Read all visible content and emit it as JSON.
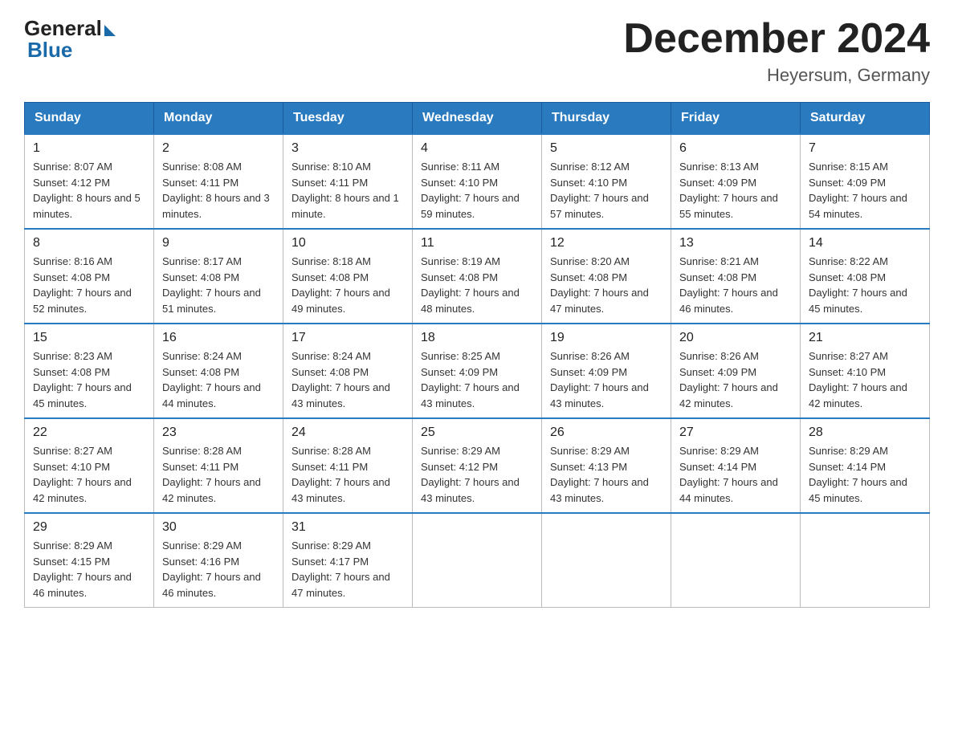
{
  "logo": {
    "general": "General",
    "blue": "Blue"
  },
  "title": "December 2024",
  "location": "Heyersum, Germany",
  "weekdays": [
    "Sunday",
    "Monday",
    "Tuesday",
    "Wednesday",
    "Thursday",
    "Friday",
    "Saturday"
  ],
  "rows": [
    [
      {
        "day": "1",
        "sunrise": "8:07 AM",
        "sunset": "4:12 PM",
        "daylight": "8 hours and 5 minutes."
      },
      {
        "day": "2",
        "sunrise": "8:08 AM",
        "sunset": "4:11 PM",
        "daylight": "8 hours and 3 minutes."
      },
      {
        "day": "3",
        "sunrise": "8:10 AM",
        "sunset": "4:11 PM",
        "daylight": "8 hours and 1 minute."
      },
      {
        "day": "4",
        "sunrise": "8:11 AM",
        "sunset": "4:10 PM",
        "daylight": "7 hours and 59 minutes."
      },
      {
        "day": "5",
        "sunrise": "8:12 AM",
        "sunset": "4:10 PM",
        "daylight": "7 hours and 57 minutes."
      },
      {
        "day": "6",
        "sunrise": "8:13 AM",
        "sunset": "4:09 PM",
        "daylight": "7 hours and 55 minutes."
      },
      {
        "day": "7",
        "sunrise": "8:15 AM",
        "sunset": "4:09 PM",
        "daylight": "7 hours and 54 minutes."
      }
    ],
    [
      {
        "day": "8",
        "sunrise": "8:16 AM",
        "sunset": "4:08 PM",
        "daylight": "7 hours and 52 minutes."
      },
      {
        "day": "9",
        "sunrise": "8:17 AM",
        "sunset": "4:08 PM",
        "daylight": "7 hours and 51 minutes."
      },
      {
        "day": "10",
        "sunrise": "8:18 AM",
        "sunset": "4:08 PM",
        "daylight": "7 hours and 49 minutes."
      },
      {
        "day": "11",
        "sunrise": "8:19 AM",
        "sunset": "4:08 PM",
        "daylight": "7 hours and 48 minutes."
      },
      {
        "day": "12",
        "sunrise": "8:20 AM",
        "sunset": "4:08 PM",
        "daylight": "7 hours and 47 minutes."
      },
      {
        "day": "13",
        "sunrise": "8:21 AM",
        "sunset": "4:08 PM",
        "daylight": "7 hours and 46 minutes."
      },
      {
        "day": "14",
        "sunrise": "8:22 AM",
        "sunset": "4:08 PM",
        "daylight": "7 hours and 45 minutes."
      }
    ],
    [
      {
        "day": "15",
        "sunrise": "8:23 AM",
        "sunset": "4:08 PM",
        "daylight": "7 hours and 45 minutes."
      },
      {
        "day": "16",
        "sunrise": "8:24 AM",
        "sunset": "4:08 PM",
        "daylight": "7 hours and 44 minutes."
      },
      {
        "day": "17",
        "sunrise": "8:24 AM",
        "sunset": "4:08 PM",
        "daylight": "7 hours and 43 minutes."
      },
      {
        "day": "18",
        "sunrise": "8:25 AM",
        "sunset": "4:09 PM",
        "daylight": "7 hours and 43 minutes."
      },
      {
        "day": "19",
        "sunrise": "8:26 AM",
        "sunset": "4:09 PM",
        "daylight": "7 hours and 43 minutes."
      },
      {
        "day": "20",
        "sunrise": "8:26 AM",
        "sunset": "4:09 PM",
        "daylight": "7 hours and 42 minutes."
      },
      {
        "day": "21",
        "sunrise": "8:27 AM",
        "sunset": "4:10 PM",
        "daylight": "7 hours and 42 minutes."
      }
    ],
    [
      {
        "day": "22",
        "sunrise": "8:27 AM",
        "sunset": "4:10 PM",
        "daylight": "7 hours and 42 minutes."
      },
      {
        "day": "23",
        "sunrise": "8:28 AM",
        "sunset": "4:11 PM",
        "daylight": "7 hours and 42 minutes."
      },
      {
        "day": "24",
        "sunrise": "8:28 AM",
        "sunset": "4:11 PM",
        "daylight": "7 hours and 43 minutes."
      },
      {
        "day": "25",
        "sunrise": "8:29 AM",
        "sunset": "4:12 PM",
        "daylight": "7 hours and 43 minutes."
      },
      {
        "day": "26",
        "sunrise": "8:29 AM",
        "sunset": "4:13 PM",
        "daylight": "7 hours and 43 minutes."
      },
      {
        "day": "27",
        "sunrise": "8:29 AM",
        "sunset": "4:14 PM",
        "daylight": "7 hours and 44 minutes."
      },
      {
        "day": "28",
        "sunrise": "8:29 AM",
        "sunset": "4:14 PM",
        "daylight": "7 hours and 45 minutes."
      }
    ],
    [
      {
        "day": "29",
        "sunrise": "8:29 AM",
        "sunset": "4:15 PM",
        "daylight": "7 hours and 46 minutes."
      },
      {
        "day": "30",
        "sunrise": "8:29 AM",
        "sunset": "4:16 PM",
        "daylight": "7 hours and 46 minutes."
      },
      {
        "day": "31",
        "sunrise": "8:29 AM",
        "sunset": "4:17 PM",
        "daylight": "7 hours and 47 minutes."
      },
      null,
      null,
      null,
      null
    ]
  ]
}
